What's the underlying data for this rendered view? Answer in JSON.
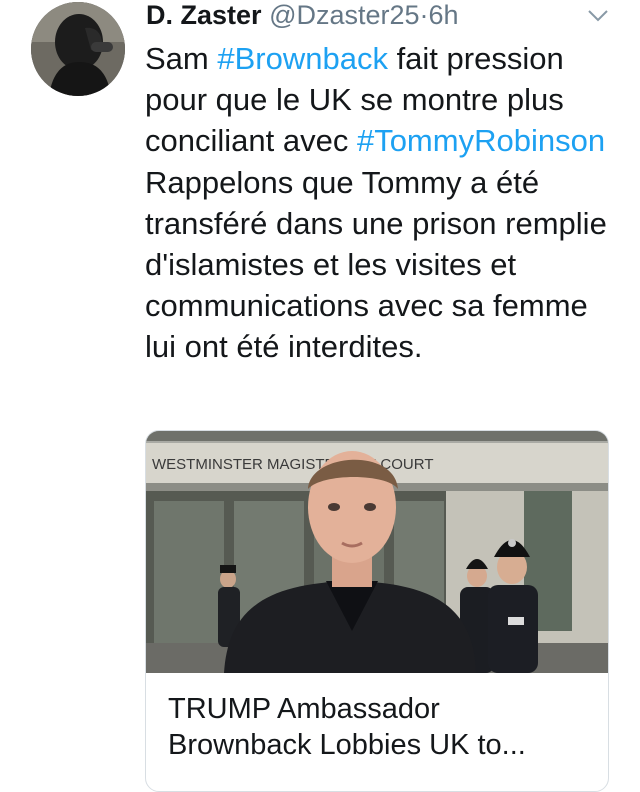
{
  "tweet": {
    "author_name": "D. Zaster",
    "author_handle": "@Dzaster25",
    "separator": "·",
    "time": "6h",
    "text": [
      {
        "t": "Sam ",
        "tag": false
      },
      {
        "t": "#Brownback",
        "tag": true
      },
      {
        "t": " fait pression pour que le UK se montre plus conciliant avec ",
        "tag": false
      },
      {
        "t": "#TommyRobinson",
        "tag": true
      },
      {
        "t": " Rappelons que Tommy a été transféré dans une prison remplie d'islamistes et les visites et communications avec sa femme lui ont été interdites.",
        "tag": false
      }
    ],
    "link_color": "#1da1f2",
    "icons": {
      "menu": "chevron-down-icon"
    }
  },
  "card": {
    "image_sign_text": "WESTMINSTER MAGISTRATES' COURT",
    "title_line1": "TRUMP Ambassador",
    "title_line2": "Brownback Lobbies UK to..."
  }
}
